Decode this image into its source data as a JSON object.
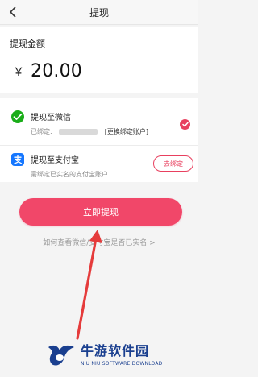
{
  "nav": {
    "title": "提现",
    "back_icon": "chevron-left-icon"
  },
  "amount": {
    "label": "提现金额",
    "currency": "￥",
    "value": "20.00"
  },
  "methods": {
    "wechat": {
      "name": "提现至微信",
      "bound_prefix": "已绑定:",
      "change_link": "[更换绑定账户]",
      "icon": "wechat-icon",
      "selected": true
    },
    "alipay": {
      "name": "提现至支付宝",
      "hint": "需绑定已实名的支付宝账户",
      "action": "去绑定",
      "icon": "alipay-icon"
    }
  },
  "actions": {
    "withdraw_label": "立即提现",
    "help_link": "如何查看微信/支付宝是否已实名 >"
  },
  "watermark": {
    "cn": "牛游软件园",
    "en": "NIU NIU SOFTWARE DOWNLOAD"
  },
  "colors": {
    "accent": "#f14769",
    "wechat": "#1aad19",
    "alipay": "#1677ff",
    "annotation": "#e53b3b"
  }
}
